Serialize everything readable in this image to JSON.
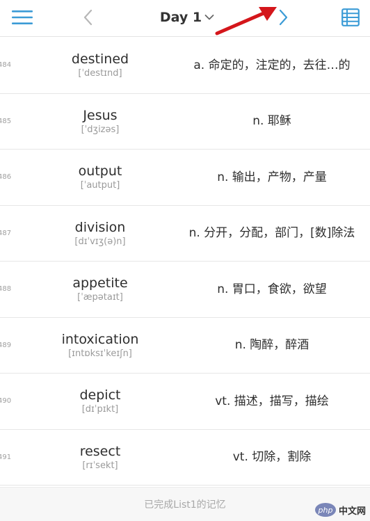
{
  "header": {
    "day_label": "Day 1",
    "icons": {
      "menu": "hamburger-menu-icon",
      "prev": "chevron-left-icon",
      "next": "chevron-right-icon",
      "dropdown": "chevron-down-icon",
      "list": "list-view-icon"
    }
  },
  "colors": {
    "accent": "#3b9bd6",
    "nav_gray": "#b7b7b7",
    "annotation_red": "#d4161b"
  },
  "words": [
    {
      "index": "484",
      "word": "destined",
      "phonetic": "[ˈdestɪnd]",
      "meaning": "a. 命定的，注定的，去往…的"
    },
    {
      "index": "485",
      "word": "Jesus",
      "phonetic": "[ˈdʒizəs]",
      "meaning": "n. 耶稣"
    },
    {
      "index": "486",
      "word": "output",
      "phonetic": "[ˈautput]",
      "meaning": "n. 输出，产物，产量"
    },
    {
      "index": "487",
      "word": "division",
      "phonetic": "[dɪˈvɪʒ(ə)n]",
      "meaning": "n. 分开，分配，部门，[数]除法"
    },
    {
      "index": "488",
      "word": "appetite",
      "phonetic": "[ˈæpətaɪt]",
      "meaning": "n. 胃口，食欲，欲望"
    },
    {
      "index": "489",
      "word": "intoxication",
      "phonetic": "[ɪntɒksɪˈkeɪʃn]",
      "meaning": "n. 陶醉，醉酒"
    },
    {
      "index": "490",
      "word": "depict",
      "phonetic": "[dɪˈpɪkt]",
      "meaning": "vt. 描述，描写，描绘"
    },
    {
      "index": "491",
      "word": "resect",
      "phonetic": "[rɪˈsekt]",
      "meaning": "vt. 切除，割除"
    }
  ],
  "footer": {
    "status": "已完成List1的记忆"
  },
  "watermark": {
    "php": "php",
    "site": "中文网"
  }
}
